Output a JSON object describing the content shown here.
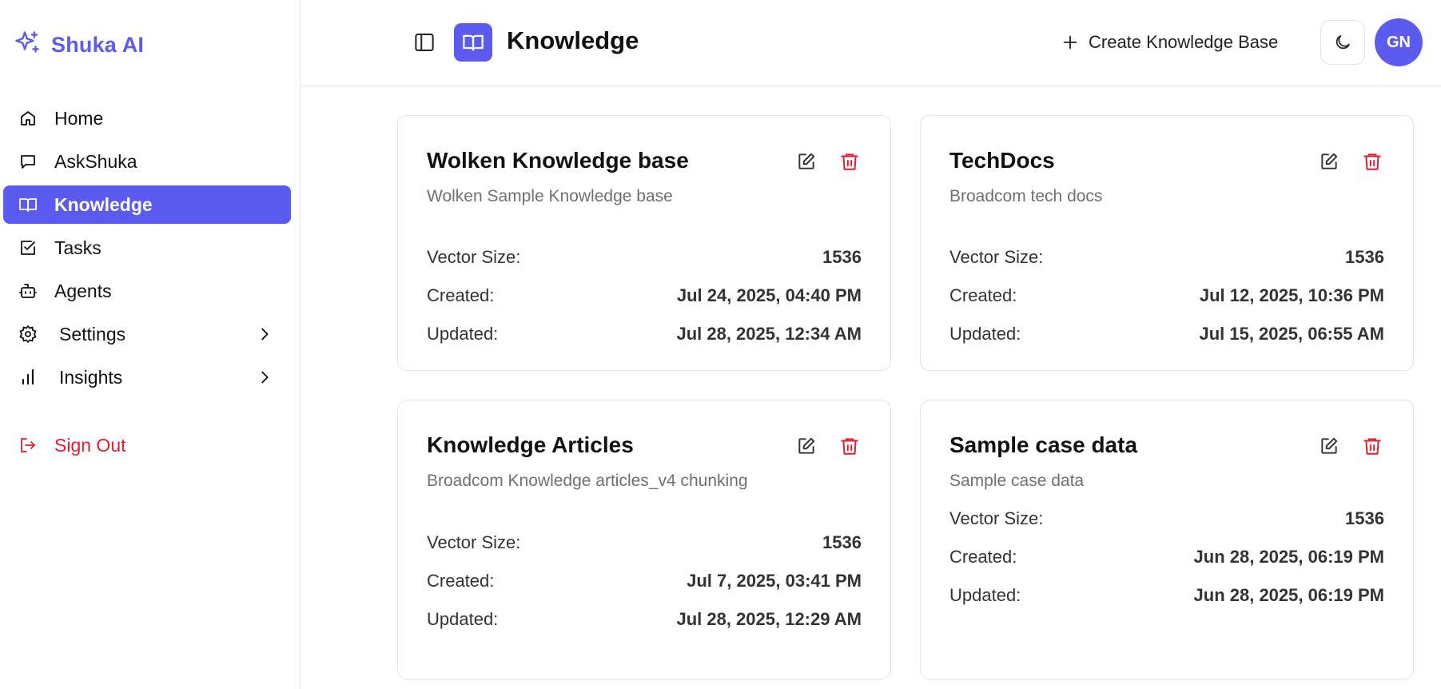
{
  "brand": {
    "name": "Shuka AI",
    "color": "#5b5bf0"
  },
  "sidebar": {
    "items": [
      {
        "label": "Home",
        "icon": "home-icon"
      },
      {
        "label": "AskShuka",
        "icon": "message-square-icon"
      },
      {
        "label": "Knowledge",
        "icon": "book-open-icon",
        "active": true
      },
      {
        "label": "Tasks",
        "icon": "square-check-icon"
      },
      {
        "label": "Agents",
        "icon": "bot-icon"
      },
      {
        "label": "Settings",
        "icon": "gear-icon",
        "expandable": true
      },
      {
        "label": "Insights",
        "icon": "bar-chart-icon",
        "expandable": true
      }
    ],
    "sign_out": {
      "label": "Sign Out",
      "icon": "log-out-icon",
      "color": "#e11d2f"
    }
  },
  "header": {
    "title": "Knowledge",
    "create_label": "Create Knowledge Base",
    "theme_icon": "moon-icon",
    "avatar_initials": "GN"
  },
  "cards": [
    {
      "title": "Wolken Knowledge base",
      "description": "Wolken Sample Knowledge base",
      "vector_size_label": "Vector Size:",
      "vector_size": "1536",
      "created_label": "Created:",
      "created": "Jul 24, 2025, 04:40 PM",
      "updated_label": "Updated:",
      "updated": "Jul 28, 2025, 12:34 AM"
    },
    {
      "title": "TechDocs",
      "description": "Broadcom tech docs",
      "vector_size_label": "Vector Size:",
      "vector_size": "1536",
      "created_label": "Created:",
      "created": "Jul 12, 2025, 10:36 PM",
      "updated_label": "Updated:",
      "updated": "Jul 15, 2025, 06:55 AM"
    },
    {
      "title": "Knowledge Articles",
      "description": "Broadcom Knowledge articles_v4 chunking",
      "vector_size_label": "Vector Size:",
      "vector_size": "1536",
      "created_label": "Created:",
      "created": "Jul 7, 2025, 03:41 PM",
      "updated_label": "Updated:",
      "updated": "Jul 28, 2025, 12:29 AM"
    },
    {
      "title": "Sample case data",
      "description": "Sample case data",
      "vector_size_label": "Vector Size:",
      "vector_size": "1536",
      "created_label": "Created:",
      "created": "Jun 28, 2025, 06:19 PM",
      "updated_label": "Updated:",
      "updated": "Jun 28, 2025, 06:19 PM"
    }
  ]
}
